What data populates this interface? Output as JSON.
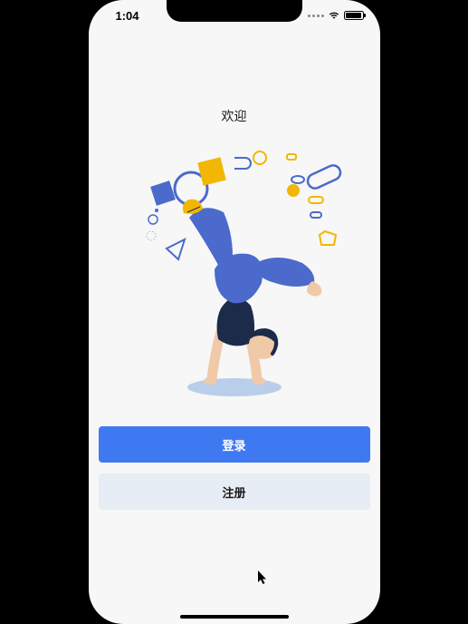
{
  "statusBar": {
    "time": "1:04"
  },
  "welcome": {
    "title": "欢迎"
  },
  "buttons": {
    "login": "登录",
    "register": "注册"
  },
  "colors": {
    "primary": "#3f79f2",
    "secondary": "#e7edf4",
    "accent": "#f2b705",
    "navy": "#1c2b4a",
    "pants": "#4c6acb",
    "skin": "#f0c9a8",
    "background": "#f6f7f6"
  }
}
